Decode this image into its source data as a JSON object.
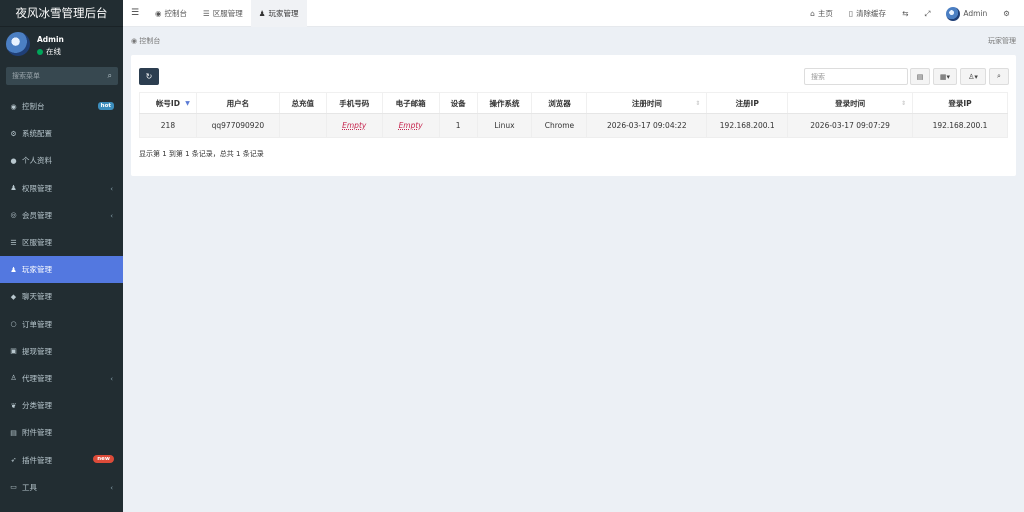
{
  "brand": "夜风冰雪管理后台",
  "user": {
    "name": "Admin",
    "status": "在线"
  },
  "sidebar_search": {
    "placeholder": "搜索菜单"
  },
  "menu": [
    {
      "label": "控制台",
      "icon": "dashboard-icon",
      "glyph": "◉",
      "badge": "hot"
    },
    {
      "label": "系统配置",
      "icon": "gear-icon",
      "glyph": "⚙"
    },
    {
      "label": "个人资料",
      "icon": "user-icon",
      "glyph": "●"
    },
    {
      "label": "权限管理",
      "icon": "group-icon",
      "glyph": "♟",
      "chevron": true
    },
    {
      "label": "会员管理",
      "icon": "user-circle-icon",
      "glyph": "◎",
      "chevron": true
    },
    {
      "label": "区服管理",
      "icon": "list-icon",
      "glyph": "☰"
    },
    {
      "label": "玩家管理",
      "icon": "users-icon",
      "glyph": "♟",
      "active": true
    },
    {
      "label": "聊天管理",
      "icon": "chat-icon",
      "glyph": "◆"
    },
    {
      "label": "订单管理",
      "icon": "circle-icon",
      "glyph": "○"
    },
    {
      "label": "提现管理",
      "icon": "money-icon",
      "glyph": "▣"
    },
    {
      "label": "代理管理",
      "icon": "agent-icon",
      "glyph": "♙",
      "chevron": true
    },
    {
      "label": "分类管理",
      "icon": "leaf-icon",
      "glyph": "❦"
    },
    {
      "label": "附件管理",
      "icon": "file-icon",
      "glyph": "▤"
    },
    {
      "label": "插件管理",
      "icon": "rocket-icon",
      "glyph": "➶",
      "badge": "new"
    },
    {
      "label": "工具",
      "icon": "tool-icon",
      "glyph": "▭",
      "chevron": true
    }
  ],
  "header": {
    "tabs": [
      {
        "label": "控制台",
        "icon": "dashboard-icon"
      },
      {
        "label": "区服管理",
        "icon": "list-icon"
      },
      {
        "label": "玩家管理",
        "icon": "users-icon",
        "active": true
      }
    ],
    "home": "主页",
    "clear_cache": "清除缓存",
    "admin": "Admin"
  },
  "breadcrumb": {
    "left": "控制台",
    "right": "玩家管理"
  },
  "table": {
    "search_placeholder": "搜索",
    "columns": [
      "帐号ID",
      "用户名",
      "总充值",
      "手机号码",
      "电子邮箱",
      "设备",
      "操作系统",
      "浏览器",
      "注册时间",
      "注册IP",
      "登录时间",
      "登录IP"
    ],
    "rows": [
      [
        "218",
        "qq977090920",
        "",
        "Empty",
        "Empty",
        "1",
        "Linux",
        "Chrome",
        "2026-03-17 09:04:22",
        "192.168.200.1",
        "2026-03-17 09:07:29",
        "192.168.200.1"
      ]
    ],
    "footer": "显示第 1 到第 1 条记录，总共 1 条记录"
  }
}
